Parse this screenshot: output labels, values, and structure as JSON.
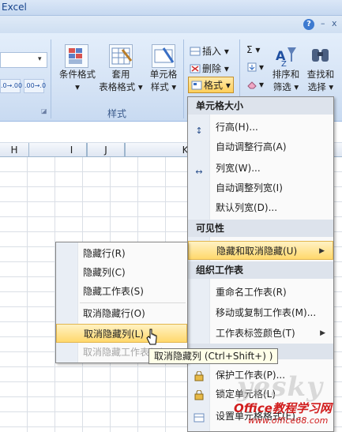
{
  "app": {
    "title": "Excel"
  },
  "window": {
    "help": "?",
    "minimize": "–",
    "close": "x"
  },
  "ribbon": {
    "number_buttons": [
      ".0→.00",
      ".00→.0"
    ],
    "styles_group": {
      "label": "样式",
      "conditional_formatting": [
        "条件格式",
        "▾"
      ],
      "format_as_table": [
        "套用",
        "表格格式 ▾"
      ],
      "cell_styles": [
        "单元格",
        "样式 ▾"
      ]
    },
    "cells_group": {
      "insert": "插入 ▾",
      "delete": "删除 ▾",
      "format": "格式 ▾"
    },
    "editing_group": {
      "sigma": "Σ ▾",
      "fill": "▾",
      "clear": "▾",
      "sort_filter": [
        "排序和",
        "筛选 ▾"
      ],
      "find_select": [
        "查找和",
        "选择 ▾"
      ]
    }
  },
  "columns": [
    "H",
    "I",
    "J",
    "K"
  ],
  "main_menu": {
    "sections": {
      "cell_size": "单元格大小",
      "visibility": "可见性",
      "organize": "组织工作表"
    },
    "items": {
      "row_height": "行高(H)...",
      "autofit_row": "自动调整行高(A)",
      "col_width": "列宽(W)...",
      "autofit_col": "自动调整列宽(I)",
      "default_width": "默认列宽(D)...",
      "hide_unhide": "隐藏和取消隐藏(U)",
      "rename_sheet": "重命名工作表(R)",
      "move_copy": "移动或复制工作表(M)...",
      "tab_color": "工作表标签颜色(T)",
      "protect": "保护工作表(P)...",
      "lock_cell": "锁定单元格(L)",
      "format_cells": "设置单元格格式(E)..."
    }
  },
  "submenu": {
    "hide_rows": "隐藏行(R)",
    "hide_cols": "隐藏列(C)",
    "hide_sheet": "隐藏工作表(S)",
    "unhide_rows": "取消隐藏行(O)",
    "unhide_cols": "取消隐藏列(L)",
    "unhide_sheet": "取消隐藏工作表(H)..."
  },
  "tooltip": "取消隐藏列 (Ctrl+Shift+) )",
  "watermark": {
    "yesky": "yesky",
    "office": "Office教程学习网",
    "url": "www.office68.com"
  },
  "colors": {
    "accent": "#15428b",
    "highlight": "#ffd86c",
    "section_bg": "#dde3ec"
  }
}
